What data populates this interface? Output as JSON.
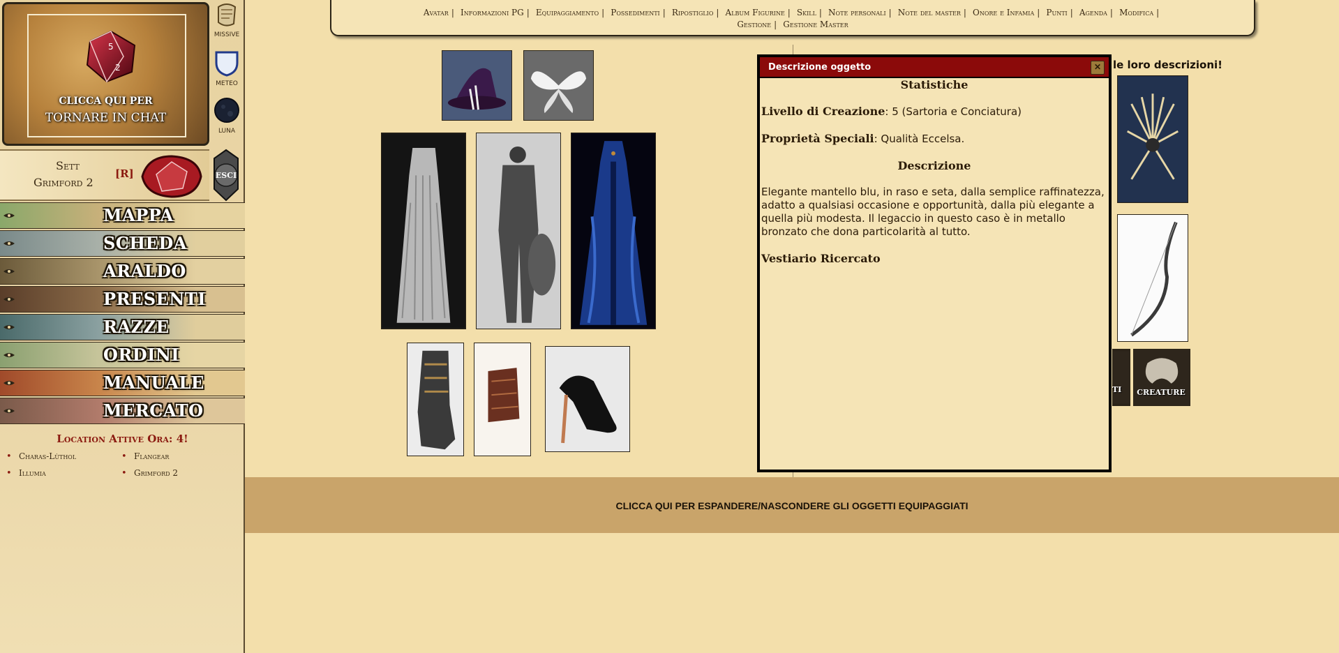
{
  "sidebar": {
    "chat_line1": "CLICCA QUI PER",
    "chat_line2": "TORNARE IN CHAT",
    "icons": {
      "missive": "MISSIVE",
      "meteo": "METEO",
      "luna": "LUNA"
    },
    "user": {
      "name1": "Sett",
      "name2": "Grimford 2",
      "tag": "[R]"
    },
    "esci_label": "ESCI",
    "nav": [
      "MAPPA",
      "SCHEDA",
      "ARALDO",
      "PRESENTI",
      "RAZZE",
      "ORDINI",
      "MANUALE",
      "MERCATO"
    ],
    "locations_title": "Location Attive Ora: 4!",
    "locations": [
      "Charas-Lùthol",
      "Flangear",
      "Illumia",
      "Grimford 2"
    ]
  },
  "topnav": {
    "items": [
      "Avatar",
      "Informazioni PG",
      "Equipaggiamento",
      "Possedimenti",
      "Ripostiglio",
      "Album Figurine",
      "Skill",
      "Note personali",
      "Note del master",
      "Onore e Infamia",
      "Punti",
      "Agenda",
      "Modifica",
      "Gestione",
      "Gestione Master"
    ]
  },
  "right": {
    "heading": "le loro descrizioni!",
    "creature_label": "CREATURE",
    "ti_label": "TI"
  },
  "modal": {
    "title": "Descrizione oggetto",
    "stat_heading": "Statistiche",
    "level_label": "Livello di Creazione",
    "level_value": ": 5 (Sartoria e Conciatura)",
    "prop_label": "Proprietà Speciali",
    "prop_value": ": Qualità Eccelsa.",
    "desc_heading": "Descrizione",
    "description": "Elegante mantello blu, in raso e seta, dalla semplice raffinatezza, adatto a qualsiasi occasione e opportunità, dalla più elegante a quella più modesta. Il legaccio in questo caso è in metallo bronzato che dona particolarità al tutto.",
    "category": "Vestiario Ricercato"
  },
  "expand_bar": "CLICCA QUI PER ESPANDERE/NASCONDERE GLI OGGETTI EQUIPAGGIATI",
  "colors": {
    "modal_header": "#8b0a0a",
    "accent_red": "#8b1a10",
    "background": "#f3dfab"
  }
}
